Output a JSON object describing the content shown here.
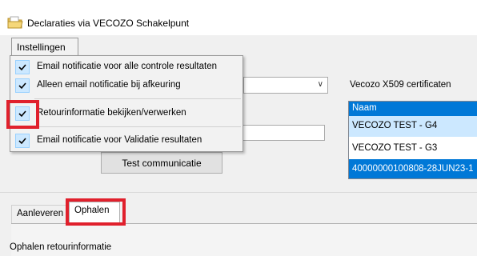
{
  "window": {
    "title": "Declaraties via VECOZO Schakelpunt",
    "icon": "app-folder-icon"
  },
  "menu": {
    "label": "Instellingen",
    "items": [
      {
        "label": "Email notificatie voor alle controle resultaten",
        "checked": true
      },
      {
        "label": "Alleen email notificatie bij afkeuring",
        "checked": true
      },
      {
        "label": "Retourinformatie bekijken/verwerken",
        "checked": true
      },
      {
        "label": "Email notificatie voor Validatie resultaten",
        "checked": true
      }
    ]
  },
  "certificates": {
    "label": "Vecozo X509 certificaten",
    "header": "Naam",
    "rows": [
      "VECOZO TEST - G4",
      "VECOZO TEST - G3",
      "40000000100808-28JUN23-1"
    ]
  },
  "buttons": {
    "test_communication": "Test communicatie"
  },
  "tabs": {
    "aanleveren": "Aanleveren",
    "ophalen": "Ophalen"
  },
  "panel": {
    "label": "Ophalen retourinformatie"
  },
  "colors": {
    "selection": "#0078d7",
    "highlight_box": "#e0202c",
    "check_bg": "#cce8ff"
  }
}
